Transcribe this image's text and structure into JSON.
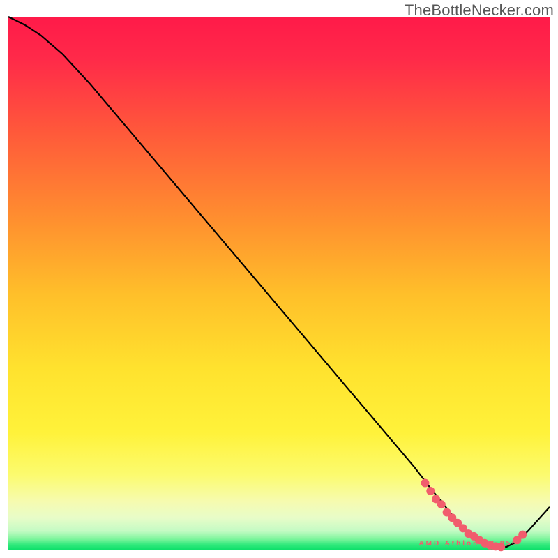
{
  "watermark": "TheBottleNecker.com",
  "chart_data": {
    "type": "line",
    "title": "",
    "xlabel": "",
    "ylabel": "",
    "xlim": [
      0,
      100
    ],
    "ylim": [
      0,
      100
    ],
    "x": [
      0,
      3,
      6,
      10,
      15,
      20,
      25,
      30,
      35,
      40,
      45,
      50,
      55,
      60,
      65,
      70,
      75,
      78,
      80,
      82,
      84,
      86,
      88,
      90,
      92,
      94,
      96,
      100
    ],
    "y": [
      100,
      98.5,
      96.5,
      93,
      87.5,
      81.5,
      75.5,
      69.5,
      63.5,
      57.5,
      51.5,
      45.5,
      39.5,
      33.5,
      27.5,
      21.5,
      15.5,
      11.5,
      9,
      6.5,
      4,
      2,
      1,
      0.5,
      0.5,
      1.5,
      3.5,
      8
    ],
    "markers": {
      "x": [
        77,
        78,
        79,
        80,
        81,
        82,
        83,
        84,
        85,
        86,
        87,
        88,
        89,
        90,
        91,
        94,
        95
      ],
      "y": [
        12.5,
        11,
        9.5,
        8.5,
        7,
        6,
        5,
        4,
        3,
        2.5,
        1.8,
        1.2,
        0.8,
        0.6,
        0.5,
        1.8,
        2.8
      ]
    },
    "inset_box": {
      "x0": 1.5,
      "y0": 3,
      "x1": 98.5,
      "y1": 98.5
    },
    "curve_annotation": {
      "text": "AMD Athlon X4 950",
      "x": 85,
      "y": 0.5
    }
  }
}
